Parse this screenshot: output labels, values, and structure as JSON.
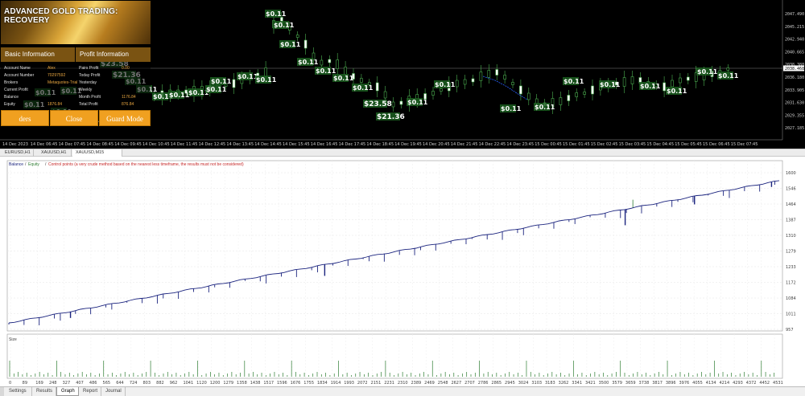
{
  "ea_panel": {
    "title": "ADVANCED GOLD TRADING: RECOVERY",
    "basic_header": "Basic Information",
    "profit_header": "Profit Information",
    "basic_rows": [
      {
        "label": "Account Name",
        "value": "Alex"
      },
      {
        "label": "Account Number",
        "value": "70297592"
      },
      {
        "label": "Brokers",
        "value": "Metaquotes-Trial"
      },
      {
        "label": "Current Profit",
        "value": ""
      },
      {
        "label": "Balance",
        "value": ""
      },
      {
        "label": "Equity",
        "value": "1876.84"
      }
    ],
    "profit_rows": [
      {
        "label": "Pairs Profit",
        "value": "0.00"
      },
      {
        "label": "Today Profit",
        "value": ""
      },
      {
        "label": "Yesterday",
        "value": ""
      },
      {
        "label": "Weekly",
        "value": ""
      },
      {
        "label": "Month Profit",
        "value": "1176.84"
      },
      {
        "label": "Total Profit",
        "value": "876.84"
      }
    ],
    "buttons": [
      "ders",
      "Close",
      "Guard Mode"
    ]
  },
  "price_chart": {
    "price_ticks": [
      "2047.490",
      "2045.215",
      "2042.940",
      "2040.665",
      "2038.388",
      "2036.180",
      "2033.905",
      "2031.630",
      "2029.355",
      "2027.185"
    ],
    "current_price": "2038.468",
    "time_ticks": [
      "14 Dec 2023",
      "14 Dec 06:45",
      "14 Dec 07:45",
      "14 Dec 08:45",
      "14 Dec 09:45",
      "14 Dec 10:45",
      "14 Dec 11:45",
      "14 Dec 12:45",
      "14 Dec 13:45",
      "14 Dec 14:45",
      "14 Dec 15:45",
      "14 Dec 16:45",
      "14 Dec 17:45",
      "14 Dec 18:45",
      "14 Dec 19:45",
      "14 Dec 20:45",
      "14 Dec 21:45",
      "14 Dec 22:45",
      "14 Dec 23:45",
      "15 Dec 00:45",
      "15 Dec 01:45",
      "15 Dec 02:45",
      "15 Dec 03:45",
      "15 Dec 04:45",
      "15 Dec 05:45",
      "15 Dec 06:45",
      "15 Dec 07:45"
    ],
    "profit_labels": [
      "$0.11",
      "$0.11",
      "$0.11",
      "$0.11",
      "$0.11",
      "$0.11",
      "$0.11",
      "$0.11",
      "$0.11",
      "$0.11",
      "$23.58",
      "$21.36",
      "$0.11",
      "$0.11",
      "$0.11",
      "$0.11"
    ]
  },
  "chart_tabs": [
    "EURUSD,H1",
    "XAUUSD,H1",
    "XAUUSD,M15 (visual)"
  ],
  "graph": {
    "legend": {
      "balance": "Balance",
      "equity": "Equity",
      "control": "Control points (a very crude method based on the nearest less timeframe, the results must not be considered)"
    },
    "balance_color": "#1a237e",
    "equity_color": "#2e7d32",
    "y_ticks": [
      "1600",
      "1546",
      "1464",
      "1387",
      "1310",
      "1279",
      "1233",
      "1172",
      "1084",
      "1011",
      "957"
    ],
    "x_ticks": [
      "0",
      "89",
      "169",
      "248",
      "327",
      "407",
      "486",
      "565",
      "644",
      "724",
      "803",
      "882",
      "962",
      "1041",
      "1120",
      "1200",
      "1279",
      "1358",
      "1438",
      "1517",
      "1596",
      "1676",
      "1755",
      "1834",
      "1914",
      "1993",
      "2072",
      "2151",
      "2231",
      "2310",
      "2389",
      "2469",
      "2548",
      "2627",
      "2707",
      "2786",
      "2865",
      "2945",
      "3024",
      "3103",
      "3183",
      "3262",
      "3341",
      "3421",
      "3500",
      "3579",
      "3659",
      "3738",
      "3817",
      "3896",
      "3976",
      "4055",
      "4134",
      "4214",
      "4293",
      "4372",
      "4452",
      "4531"
    ],
    "size_label": "Size"
  },
  "bottom_tabs": [
    "Settings",
    "Results",
    "Graph",
    "Report",
    "Journal"
  ],
  "active_bottom_tab": "Graph"
}
